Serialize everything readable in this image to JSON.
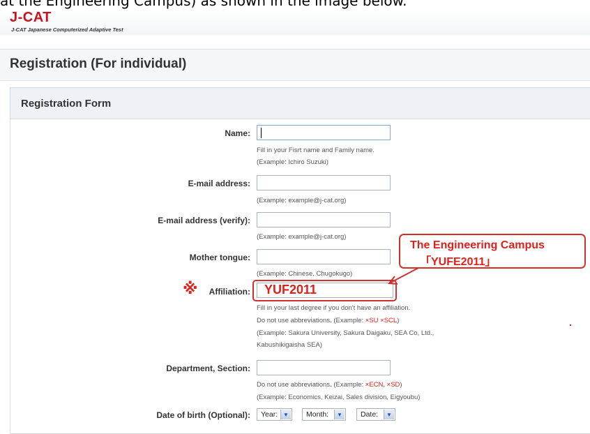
{
  "top_caption": "at the Engineering Campus) as shown in the image below.",
  "header": {
    "logo_main": "J-CAT",
    "logo_sub": "J-CAT Japanese Computerized Adaptive Test"
  },
  "page_title": "Registration (For individual)",
  "form": {
    "title": "Registration Form",
    "name": {
      "label": "Name:",
      "value": "",
      "hint1": "Fill in your Fisrt name and Family name.",
      "hint2": "(Example: Ichiro Suzuki)"
    },
    "email": {
      "label": "E-mail address:",
      "value": "",
      "hint": "(Example: example@j-cat.org)"
    },
    "email_verify": {
      "label": "E-mail address (verify):",
      "value": "",
      "hint": "(Example: example@j-cat.org)"
    },
    "mother_tongue": {
      "label": "Mother tongue:",
      "value": "",
      "hint": "(Example: Chinese, Chugokugo)"
    },
    "affiliation": {
      "mark": "※",
      "label": "Affiliation:",
      "value": "YUF2011",
      "hint1": "Fill in your last degree if you don't have an affiliation.",
      "hint2_prefix": "Do not use abbreviations. (Example: ",
      "hint2_red": "×SU ×SCL",
      "hint2_suffix": ")",
      "hint3": "(Example: Sakura University, Sakura Daigaku, SEA Co, Ltd.,",
      "hint4": "Kabushikigaisha SEA)"
    },
    "department": {
      "label": "Department, Section:",
      "value": "",
      "hint1_prefix": "Do not use abbreviations. (Example: ",
      "hint1_red": "×ECN, ×SD",
      "hint1_suffix": ")",
      "hint2": "(Example: Economics, Keizai, Sales division, Eigyoubu)"
    },
    "dob": {
      "label": "Date of birth (Optional):",
      "year": "Year:",
      "month": "Month:",
      "date": "Date:"
    }
  },
  "callout": {
    "line1": "The Engineering Campus",
    "line2": "「YUFE2011」"
  },
  "colors": {
    "accent_red": "#e0201a",
    "annotation_red": "#d0312d",
    "logo_red": "#c8141e"
  }
}
